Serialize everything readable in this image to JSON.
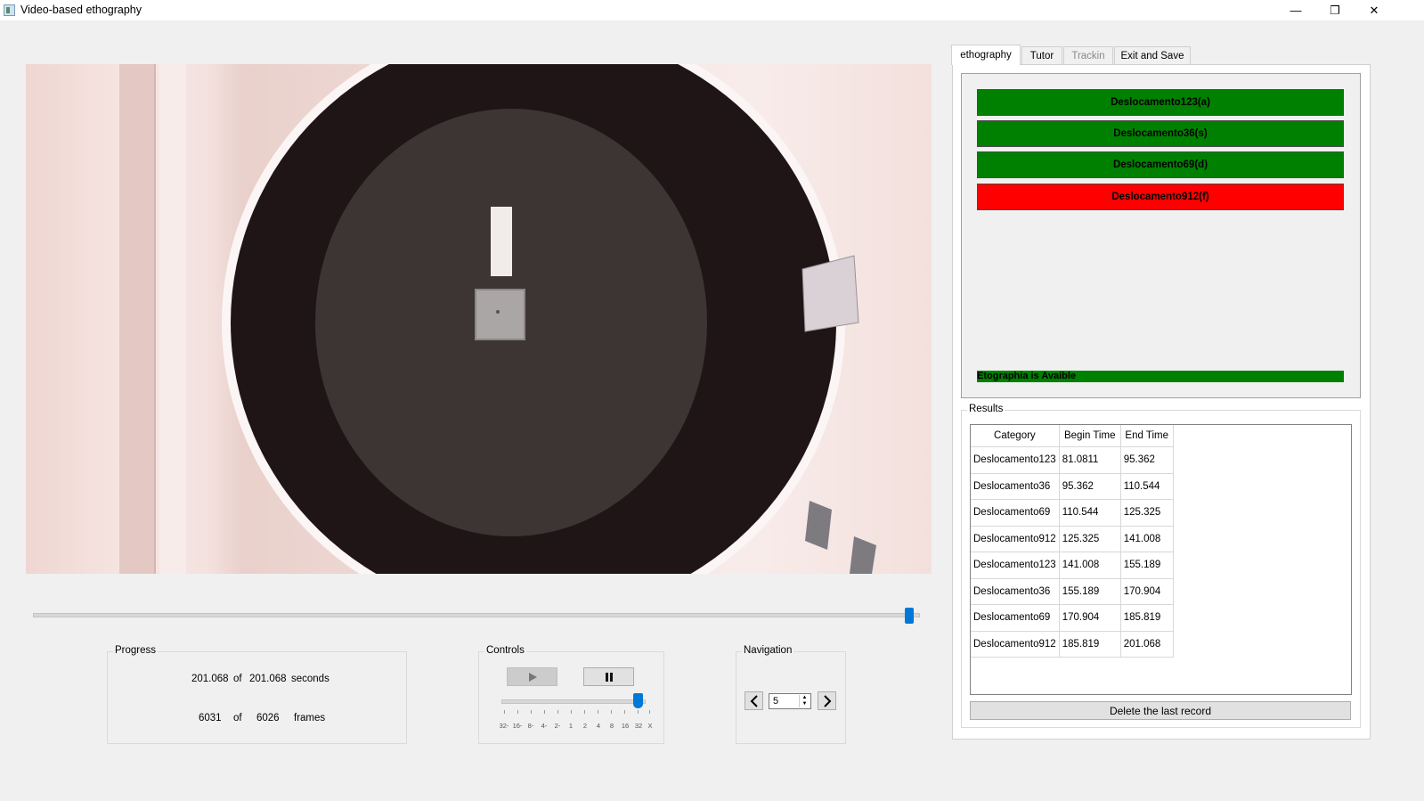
{
  "window": {
    "title": "Video-based ethography",
    "minimize": "—",
    "restore": "❐",
    "close": "✕"
  },
  "progress": {
    "title": "Progress",
    "current_seconds": "201.068",
    "of1": "of",
    "total_seconds": "201.068",
    "seconds_label": "seconds",
    "current_frame": "6031",
    "of2": "of",
    "total_frames": "6026",
    "frames_label": "frames"
  },
  "playback": {
    "position_fraction": 0.99
  },
  "controls": {
    "title": "Controls",
    "play_icon": "play-icon",
    "pause_icon": "pause-icon",
    "speed_labels": [
      "32-",
      "16-",
      "8-",
      "4-",
      "2-",
      "1",
      "2",
      "4",
      "8",
      "16",
      "32",
      "X"
    ],
    "speed_value": "32"
  },
  "navigation": {
    "title": "Navigation",
    "step_value": "5"
  },
  "tabs": [
    {
      "label": "ethography",
      "active": true
    },
    {
      "label": "Tutor",
      "active": false
    },
    {
      "label": "Trackin",
      "active": false,
      "disabled": true
    },
    {
      "label": "Exit and Save",
      "active": false
    }
  ],
  "ethography": {
    "categories": [
      {
        "label": "Deslocamento123(a)",
        "color": "#008000"
      },
      {
        "label": "Deslocamento36(s)",
        "color": "#008000"
      },
      {
        "label": "Deslocamento69(d)",
        "color": "#008000"
      },
      {
        "label": "Deslocamento912(f)",
        "color": "#ff0000"
      }
    ],
    "status": "Etographia is Avaible",
    "status_color": "#008000"
  },
  "results": {
    "title": "Results",
    "headers": [
      "Category",
      "Begin Time",
      "End Time"
    ],
    "rows": [
      [
        "Deslocamento123",
        "81.0811",
        "95.362"
      ],
      [
        "Deslocamento36",
        "95.362",
        "110.544"
      ],
      [
        "Deslocamento69",
        "110.544",
        "125.325"
      ],
      [
        "Deslocamento912",
        "125.325",
        "141.008"
      ],
      [
        "Deslocamento123",
        "141.008",
        "155.189"
      ],
      [
        "Deslocamento36",
        "155.189",
        "170.904"
      ],
      [
        "Deslocamento69",
        "170.904",
        "185.819"
      ],
      [
        "Deslocamento912",
        "185.819",
        "201.068"
      ]
    ],
    "delete_label": "Delete the last record"
  }
}
